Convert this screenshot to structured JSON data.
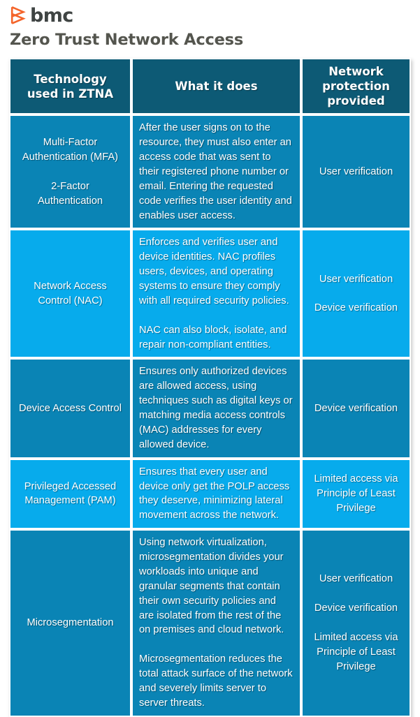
{
  "brand": {
    "logo_icon": "bmc-logo-icon",
    "logo_text": "bmc",
    "logo_mark_color": "#f4642a",
    "logo_text_color": "#3f4443"
  },
  "page_title": "Zero Trust Network Access",
  "colors": {
    "header_bg": "#0d5a75",
    "row_dark_bg": "#0a84b5",
    "row_light_bg": "#07abec",
    "text": "#ffffff",
    "title_text": "#54554e",
    "page_bg": "#ffffff",
    "cell_border": "#ffffff"
  },
  "table": {
    "headers": [
      "Technology used\nin ZTNA",
      "What it does",
      "Network\nprotection\nprovided"
    ],
    "rows": [
      {
        "shade": "dark",
        "technology": "Multi-Factor\nAuthentication (MFA)\n\n2-Factor\nAuthentication",
        "what_it_does": "After the user signs on to the resource, they must also enter an access code that was sent to their registered phone number or email. Entering the requested code verifies the user identity and enables user access.",
        "protection": "User verification"
      },
      {
        "shade": "light",
        "technology": "Network Access\nControl (NAC)",
        "what_it_does": "Enforces and verifies user and device identities. NAC profiles users, devices, and operating systems to ensure they comply with all required security policies.\n\nNAC can also block, isolate, and repair non-compliant entities.",
        "protection": "User verification\n\nDevice verification"
      },
      {
        "shade": "dark",
        "technology": "Device Access Control",
        "what_it_does": "Ensures only authorized devices are allowed access, using techniques such as digital keys or matching media access controls (MAC) addresses for every allowed device.",
        "protection": "Device verification"
      },
      {
        "shade": "light",
        "technology": "Privileged Accessed\nManagement (PAM)",
        "what_it_does": "Ensures that every user and device only get the POLP access they deserve, minimizing lateral movement across the network.",
        "protection": "Limited access via\nPrinciple of Least\nPrivilege"
      },
      {
        "shade": "dark",
        "technology": "Microsegmentation",
        "what_it_does": "Using network virtualization, microsegmentation divides your workloads into unique and granular segments that contain their own security policies and are isolated from the rest of the on premises and cloud network.\n\nMicrosegmentation reduces the total attack surface of the network and severely limits server to server threats.",
        "protection": "User verification\n\nDevice verification\n\nLimited access via\nPrinciple of Least\nPrivilege"
      }
    ]
  }
}
